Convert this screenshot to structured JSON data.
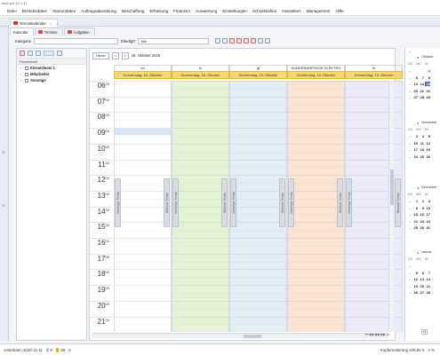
{
  "title_fragment": "sorit (v1.12.1.4)",
  "menu": [
    "Datei",
    "Betriebsdaten",
    "Stammdaten",
    "Auftragsabwicklung",
    "Beschaffung",
    "Erfassung",
    "Finanzen",
    "Auswertung",
    "Einstellungen",
    "Schnittstellen",
    "Interaktion",
    "Management",
    "Hilfe"
  ],
  "doc_tab": {
    "label": "Terminkalender",
    "close": "×"
  },
  "inner_tabs": [
    {
      "label": "Kalender",
      "active": true
    },
    {
      "label": "Termine",
      "active": false
    },
    {
      "label": "Aufgaben",
      "active": false
    }
  ],
  "filter": {
    "kategorie_label": "Kategorie",
    "erledigt_label": "Erledigt?",
    "erledigt_value": "Alle"
  },
  "tree": {
    "header": "Planeinheit",
    "items": [
      "Einsatzteam 1",
      "Mitarbeiter",
      "Sonstige"
    ]
  },
  "nav": {
    "today_button": "Heute",
    "prev": "<",
    "next": ">",
    "current_date": "16. Oktober 2025"
  },
  "columns": [
    {
      "name": "cd",
      "date": "Donnerstag, 16. Oktober",
      "color": "#ffffff"
    },
    {
      "name": "fn",
      "date": "Donnerstag, 16. Oktober",
      "color": "#e6f2d8"
    },
    {
      "name": "gf",
      "date": "Donnerstag, 16. Oktober",
      "color": "#e3edf5"
    },
    {
      "name": "KUNDENANFRAGE ELEKTRO",
      "date": "Donnerstag, 16. Oktober",
      "color": "#fae4d4"
    },
    {
      "name": "lo",
      "date": "Donnerstag, 16. Oktober",
      "color": "#ecebfa"
    }
  ],
  "hours": [
    "06",
    "07",
    "08",
    "09",
    "10",
    "11",
    "12",
    "13",
    "14",
    "15",
    "16",
    "17",
    "18",
    "19",
    "20",
    "21"
  ],
  "minute_sup": "00",
  "side_tabs": {
    "prev": "Vorheriger Termin",
    "next": "Nächster Termin"
  },
  "pager_text": "⏮ ◀◀ ◀ ▶ ▶▶ ⏭",
  "minicalendar": {
    "weekdays": [
      "DO",
      "MO",
      "MI"
    ],
    "months": [
      {
        "name": "Oktober",
        "rows": [
          [
            "",
            "",
            "1"
          ],
          [
            "6",
            "7",
            "8"
          ],
          [
            "13",
            "14",
            "15"
          ],
          [
            "20",
            "21",
            "22"
          ],
          [
            "27",
            "28",
            "29"
          ]
        ],
        "today": "15"
      },
      {
        "name": "November",
        "rows": [
          [
            "3",
            "4",
            "5"
          ],
          [
            "10",
            "11",
            "12"
          ],
          [
            "17",
            "18",
            "19"
          ],
          [
            "24",
            "25",
            "26"
          ]
        ]
      },
      {
        "name": "Dezember",
        "rows": [
          [
            "1",
            "2",
            "3"
          ],
          [
            "8",
            "9",
            "10"
          ],
          [
            "15",
            "16",
            "17"
          ],
          [
            "22",
            "23",
            "24"
          ],
          [
            "29",
            "30",
            "31"
          ]
        ]
      },
      {
        "name": "Januar",
        "rows": [
          [
            "",
            "",
            ""
          ],
          [
            "5",
            "6",
            "7"
          ],
          [
            "12",
            "13",
            "14"
          ],
          [
            "19",
            "20",
            "21"
          ],
          [
            "26",
            "27",
            "28"
          ]
        ]
      }
    ],
    "footer": "Hi"
  },
  "status": {
    "left": "osterdaten 2020-11-11",
    "count1": "0",
    "count2": "28",
    "count3": "0",
    "right": "Kupfernotierung 845,82 €",
    "zoom": "4 %"
  }
}
